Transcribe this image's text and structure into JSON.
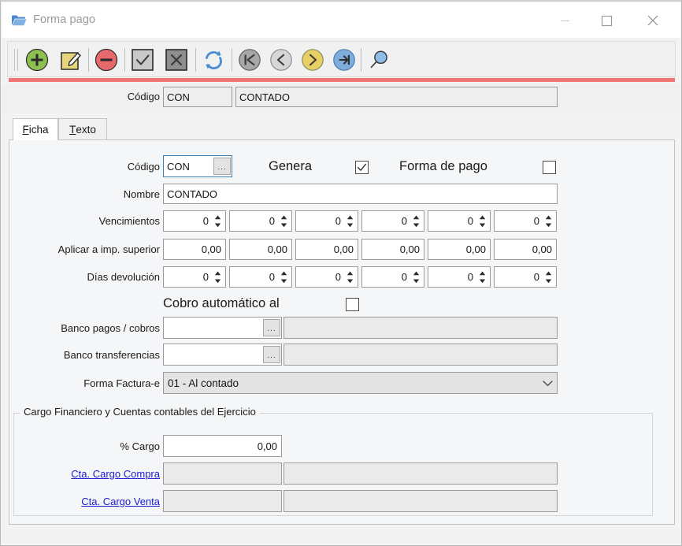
{
  "window": {
    "title": "Forma pago",
    "icon": "folder-open-icon",
    "minimize_label": "—",
    "maximize_label": "□",
    "close_label": "✕",
    "accent_line_color": "#ee7674"
  },
  "toolbar": {
    "items": [
      {
        "name": "new-record-button",
        "icon": "plus-circle-icon",
        "color": "#8cc152"
      },
      {
        "name": "edit-record-button",
        "icon": "edit-note-pencil-icon",
        "color": "#e8d47a"
      },
      {
        "name": "delete-record-button",
        "icon": "minus-circle-icon",
        "color": "#e8686b"
      },
      {
        "name": "accept-button",
        "icon": "check-square-icon",
        "color": "#c9c9c9"
      },
      {
        "name": "cancel-button",
        "icon": "x-square-icon",
        "color": "#8e8e8e"
      },
      {
        "name": "refresh-button",
        "icon": "refresh-arrows-icon",
        "color": "#5b9bd5"
      },
      {
        "name": "first-record-button",
        "icon": "go-first-icon",
        "color": "#a8a8a8"
      },
      {
        "name": "previous-record-button",
        "icon": "go-previous-icon",
        "color": "#d6d6d6"
      },
      {
        "name": "next-record-button",
        "icon": "go-next-icon",
        "color": "#e8cf63"
      },
      {
        "name": "last-record-button",
        "icon": "go-last-icon",
        "color": "#7eaede"
      },
      {
        "name": "search-button",
        "icon": "magnifier-icon",
        "color": "#8fbdea"
      }
    ]
  },
  "header": {
    "codigo_label": "Código",
    "codigo_value": "CON",
    "nombre_value": "CONTADO"
  },
  "tabs": [
    {
      "name": "tab-ficha",
      "accel": "F",
      "rest": "icha",
      "active": true
    },
    {
      "name": "tab-texto",
      "accel": "T",
      "rest": "exto",
      "active": false
    }
  ],
  "form": {
    "codigo_label": "Código",
    "codigo_value": "CON",
    "codigo_browse_label": "...",
    "genera_label": "Genera",
    "genera_checked": true,
    "forma_pago_label": "Forma de pago",
    "forma_pago_checked": false,
    "nombre_label": "Nombre",
    "nombre_value": "CONTADO",
    "vencimientos_label": "Vencimientos",
    "vencimientos_values": [
      "0",
      "0",
      "0",
      "0",
      "0",
      "0"
    ],
    "aplicar_label": "Aplicar a imp. superior",
    "aplicar_values": [
      "0,00",
      "0,00",
      "0,00",
      "0,00",
      "0,00",
      "0,00"
    ],
    "dias_label": "Días devolución",
    "dias_values": [
      "0",
      "0",
      "0",
      "0",
      "0",
      "0"
    ],
    "cobro_label": "Cobro automático al",
    "cobro_checked": false,
    "banco_pagos_label": "Banco pagos / cobros",
    "banco_pagos_value": "",
    "banco_pagos_desc": "",
    "banco_transf_label": "Banco transferencias",
    "banco_transf_value": "",
    "banco_transf_desc": "",
    "browse_label": "...",
    "forma_factura_label": "Forma Factura-e",
    "forma_factura_value": "01 - Al contado"
  },
  "group": {
    "title": "Cargo Financiero y  Cuentas contables del Ejercicio",
    "pct_cargo_label": "% Cargo",
    "pct_cargo_value": "0,00",
    "cta_compra_label": "Cta. Cargo Compra",
    "cta_compra_value": "",
    "cta_compra_desc": "",
    "cta_venta_label": "Cta. Cargo Venta",
    "cta_venta_value": "",
    "cta_venta_desc": "",
    "link_color": "#1b1bd4"
  }
}
